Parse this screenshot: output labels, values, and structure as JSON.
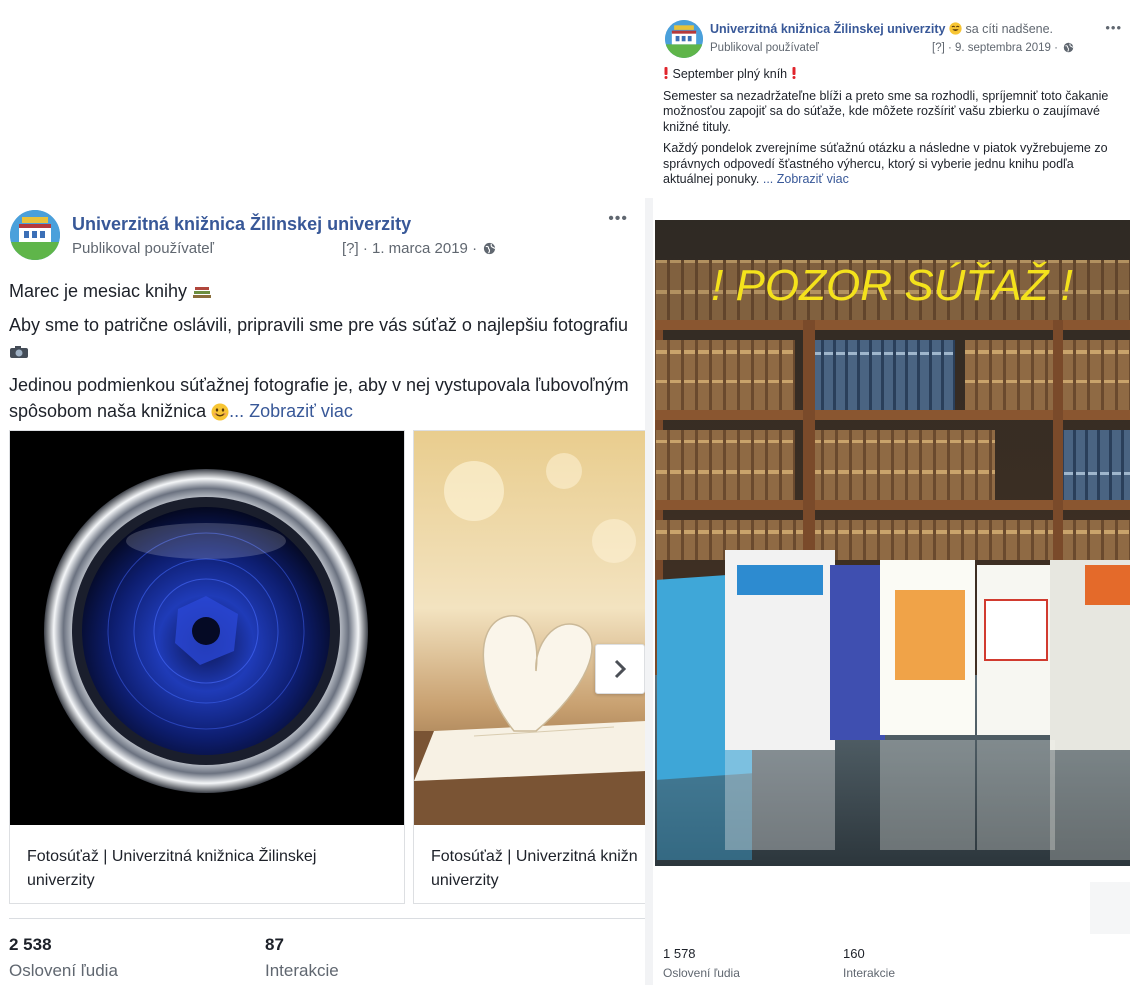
{
  "post_left": {
    "page_name": "Univerzitná knižnica Žilinskej univerzity",
    "published_by": "Publikoval používateľ",
    "date": "[?] · 1. marca 2019 ·",
    "more": "•••",
    "para1": "Marec je mesiac knihy",
    "para2": "Aby sme to patrične oslávili, pripravili sme pre vás súťaž o najlepšiu fotografiu",
    "para3": "Jedinou podmienkou súťažnej fotografie je, aby v nej vystupovala ľubovoľným spôsobom naša knižnica",
    "see_more": "... Zobraziť viac",
    "cards": [
      {
        "caption": "Fotosúťaž | Univerzitná knižnica Žilinskej univerzity"
      },
      {
        "caption": "Fotosúťaž | Univerzitná knižn"
      },
      {
        "caption_line2": "univerzity"
      }
    ],
    "stats": {
      "reach_value": "2 538",
      "reach_label": "Oslovení ľudia",
      "interactions_value": "87",
      "interactions_label": "Interakcie"
    }
  },
  "post_right": {
    "page_name": "Univerzitná knižnica Žilinskej univerzity",
    "feeling": "sa cíti nadšene.",
    "published_by": "Publikoval používateľ",
    "date": "[?] · 9. septembra 2019 ·",
    "more": "•••",
    "headline": "September plný kníh",
    "para1": "Semester sa nezadržateľne blíži a preto sme sa rozhodli, spríjemniť toto čakanie možnosťou zapojiť sa do súťaže, kde môžete rozšíriť vašu zbierku o zaujímavé knižné tituly.",
    "para2": "Každý pondelok zverejníme súťažnú otázku a následne v piatok vyžrebujeme zo správnych odpovedí šťastného výhercu, ktorý si vyberie jednu knihu podľa aktuálnej ponuky.",
    "see_more": "... Zobraziť viac",
    "photo_title": "! POZOR SÚŤAŽ !",
    "stats": {
      "reach_value": "1 578",
      "reach_label": "Oslovení ľudia",
      "interactions_value": "160",
      "interactions_label": "Interakcie"
    }
  },
  "icons": [
    "avatar-logo",
    "books-emoji",
    "camera-emoji",
    "smile-emoji",
    "globe-icon",
    "chevron-right-icon",
    "exclamation-icon"
  ],
  "colors": {
    "link": "#385898",
    "meta": "#606770",
    "text": "#1d2129",
    "border": "#dddfe2"
  }
}
